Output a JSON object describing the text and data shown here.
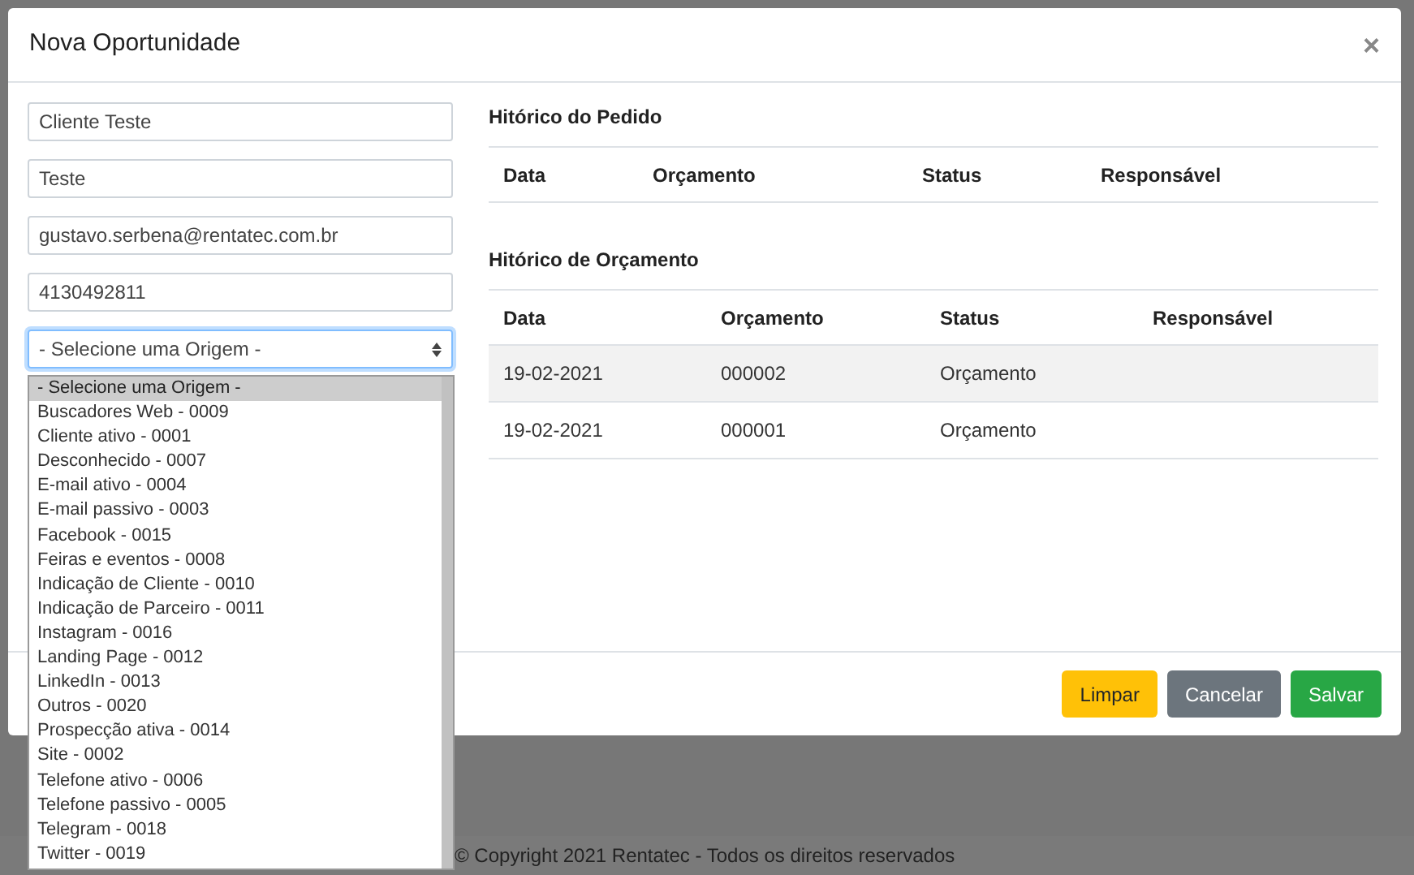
{
  "modal": {
    "title": "Nova Oportunidade",
    "close": "×",
    "fields": [
      {
        "value": "Cliente Teste"
      },
      {
        "value": "Teste"
      },
      {
        "value": "gustavo.serbena@rentatec.com.br"
      },
      {
        "value": "4130492811"
      }
    ],
    "origin_select": {
      "value": "- Selecione uma Origem -",
      "expanded": true,
      "options": [
        {
          "label": "- Selecione uma Origem -",
          "selected": true
        },
        {
          "label": "Buscadores Web - 0009",
          "selected": false
        },
        {
          "label": "Cliente ativo - 0001",
          "selected": false
        },
        {
          "label": "Desconhecido - 0007",
          "selected": false
        },
        {
          "label": "E-mail ativo - 0004",
          "selected": false
        },
        {
          "label": "E-mail passivo - 0003",
          "selected": false
        },
        {
          "label": "Facebook - 0015",
          "selected": false
        },
        {
          "label": "Feiras e eventos - 0008",
          "selected": false
        },
        {
          "label": "Indicação de Cliente - 0010",
          "selected": false
        },
        {
          "label": "Indicação de Parceiro - 0011",
          "selected": false
        },
        {
          "label": "Instagram - 0016",
          "selected": false
        },
        {
          "label": "Landing Page - 0012",
          "selected": false
        },
        {
          "label": "LinkedIn - 0013",
          "selected": false
        },
        {
          "label": "Outros - 0020",
          "selected": false
        },
        {
          "label": "Prospecção ativa - 0014",
          "selected": false
        },
        {
          "label": "Site - 0002",
          "selected": false
        },
        {
          "label": "Telefone ativo - 0006",
          "selected": false
        },
        {
          "label": "Telefone passivo - 0005",
          "selected": false
        },
        {
          "label": "Telegram - 0018",
          "selected": false
        },
        {
          "label": "Twitter - 0019",
          "selected": false
        }
      ]
    },
    "order_history": {
      "title": "Hitórico do Pedido",
      "columns": [
        "Data",
        "Orçamento",
        "Status",
        "Responsável"
      ]
    },
    "quote_history": {
      "title": "Hitórico de Orçamento",
      "columns": [
        "Data",
        "Orçamento",
        "Status",
        "Responsável"
      ],
      "rows": [
        [
          "19-02-2021",
          "000002",
          "Orçamento",
          ""
        ],
        [
          "19-02-2021",
          "000001",
          "Orçamento",
          ""
        ]
      ]
    },
    "buttons": [
      {
        "label": "Limpar",
        "kind": "warning"
      },
      {
        "label": "Cancelar",
        "kind": "secondary"
      },
      {
        "label": "Salvar",
        "kind": "success"
      }
    ]
  },
  "footer": {
    "copyright": "© Copyright 2021 Rentatec - Todos os direitos reservados"
  }
}
